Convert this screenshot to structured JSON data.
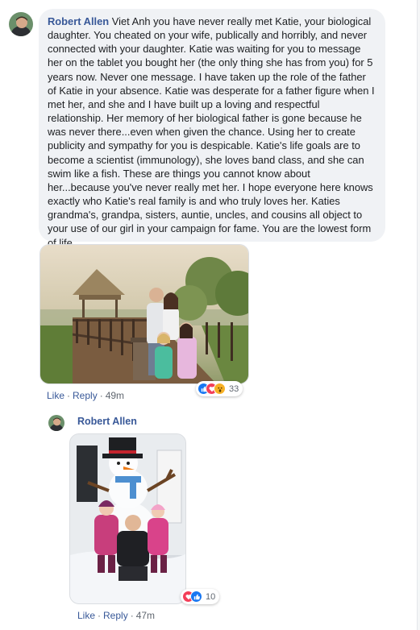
{
  "comment": {
    "author": "Robert Allen",
    "text": "Viet Anh you have never really met Katie, your biological\ndaughter. You cheated on your wife, publically and horribly, and never\nconnected with your daughter. Katie was waiting for you to message\nher on the tablet you bought her (the only thing she has from you) for 5\nyears now. Never one message. I have taken up the role of the father\nof Katie in your absence. Katie was desperate for a father figure when I\nmet her, and she and I have built up a loving and respectful\nrelationship. Her memory of her biological father is gone because he\nwas never there...even when given the chance. Using her to create\npublicity and sympathy for you is despicable. Katie's life goals are to\nbecome a scientist (immunology), she loves band class, and she can\nswim like a fish. These are things you cannot know about\nher...because you've never really met her. I hope everyone here knows\nexactly who Katie's real family is and who truly loves her. Katies\ngrandma's, grandpa, sisters, auntie, uncles, and cousins all object to\nyour use of our girl in your campaign for fame. You are the lowest form\nof life.",
    "like_label": "Like",
    "reply_label": "Reply",
    "time": "49m",
    "reaction_count": "33",
    "reactions": [
      "like",
      "love",
      "wow"
    ]
  },
  "reply": {
    "author": "Robert Allen",
    "like_label": "Like",
    "reply_label": "Reply",
    "time": "47m",
    "reaction_count": "10",
    "reactions": [
      "love",
      "like"
    ]
  },
  "colors": {
    "link": "#385898",
    "meta": "#606770",
    "bubble": "#f0f2f5",
    "like": "#1877f2",
    "love": "#f33e58",
    "wow": "#f7b125"
  }
}
